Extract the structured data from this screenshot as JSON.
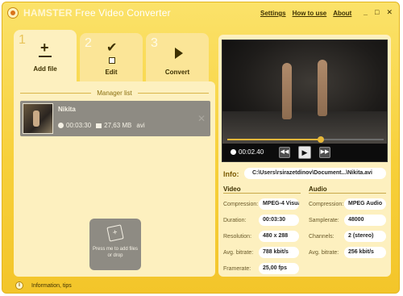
{
  "app": {
    "title_brand": "HAMSTER",
    "title_rest": " Free Video Converter"
  },
  "topnav": [
    "Settings",
    "How to use",
    "About"
  ],
  "window_buttons": [
    "_",
    "□",
    "✕"
  ],
  "steps": [
    {
      "num": "1",
      "label": "Add file"
    },
    {
      "num": "2",
      "label": "Edit"
    },
    {
      "num": "3",
      "label": "Convert"
    }
  ],
  "manager": {
    "title": "Manager list",
    "file": {
      "name": "Nikita",
      "duration": "00:03:30",
      "size": "27,63 MB",
      "ext": "avi"
    },
    "drop_text": "Press me to add files or drop"
  },
  "player": {
    "time": "00:02.40",
    "progress": 0.6
  },
  "info": {
    "label": "Info:",
    "path": "C:\\Users\\rsirazetdinov\\Document...\\Nikita.avi"
  },
  "video": {
    "heading": "Video",
    "rows": [
      {
        "label": "Compression:",
        "value": "MPEG-4 Visual"
      },
      {
        "label": "Duration:",
        "value": "00:03:30"
      },
      {
        "label": "Resolution:",
        "value": "480 x 288"
      },
      {
        "label": "Avg. bitrate:",
        "value": "788 kbit/s"
      },
      {
        "label": "Framerate:",
        "value": "25,00 fps"
      }
    ]
  },
  "audio": {
    "heading": "Audio",
    "rows": [
      {
        "label": "Compression:",
        "value": "MPEG Audio"
      },
      {
        "label": "Samplerate:",
        "value": "48000"
      },
      {
        "label": "Channels:",
        "value": "2 (stereo)"
      },
      {
        "label": "Avg. bitrate:",
        "value": "256 kbit/s"
      }
    ]
  },
  "footer": {
    "text": "Information, tips"
  }
}
